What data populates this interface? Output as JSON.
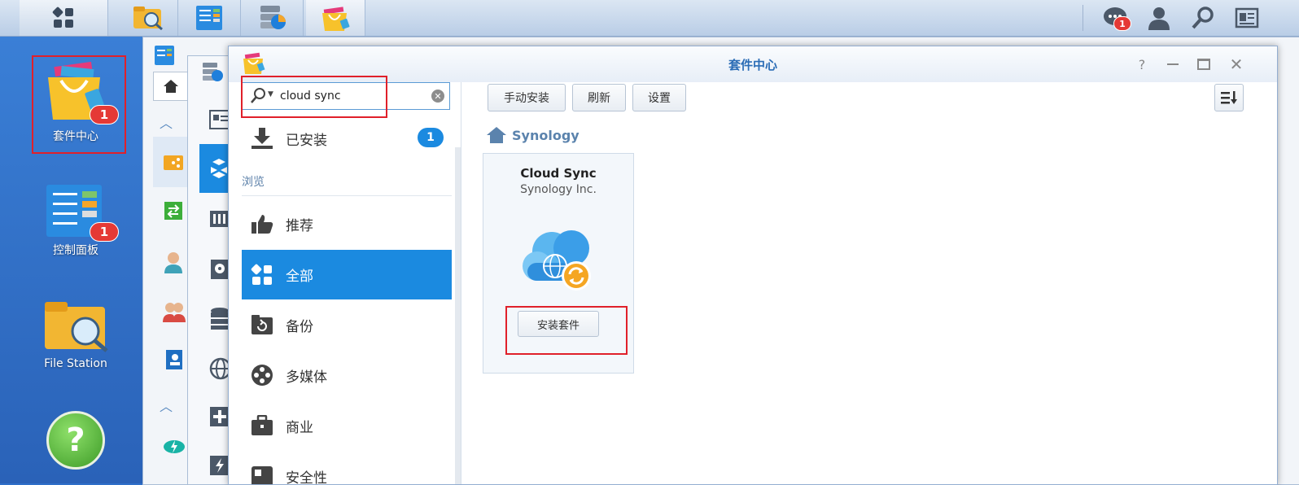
{
  "taskbar": {
    "notification_count": "1",
    "apps": [
      "main-menu-icon",
      "file-station-icon",
      "control-panel-icon",
      "storage-manager-icon",
      "package-center-icon"
    ]
  },
  "desktop": {
    "icons": [
      {
        "label": "套件中心",
        "badge": "1"
      },
      {
        "label": "控制面板",
        "badge": "1"
      },
      {
        "label": "File Station"
      },
      {
        "label": "?"
      }
    ]
  },
  "window": {
    "title": "套件中心",
    "search": {
      "value": "cloud sync",
      "placeholder": ""
    },
    "sidebar": {
      "installed_label": "已安装",
      "installed_count": "1",
      "section_browse": "浏览",
      "items": [
        {
          "label": "推荐"
        },
        {
          "label": "全部"
        },
        {
          "label": "备份"
        },
        {
          "label": "多媒体"
        },
        {
          "label": "商业"
        },
        {
          "label": "安全性"
        }
      ]
    },
    "toolbar": {
      "manual_install": "手动安装",
      "refresh": "刷新",
      "settings": "设置"
    },
    "breadcrumb": "Synology",
    "package": {
      "name": "Cloud Sync",
      "publisher": "Synology Inc.",
      "install_button": "安装套件"
    }
  },
  "colors": {
    "accent": "#1b8ae0",
    "title_blue": "#2b6db6",
    "badge_red": "#e53935"
  }
}
